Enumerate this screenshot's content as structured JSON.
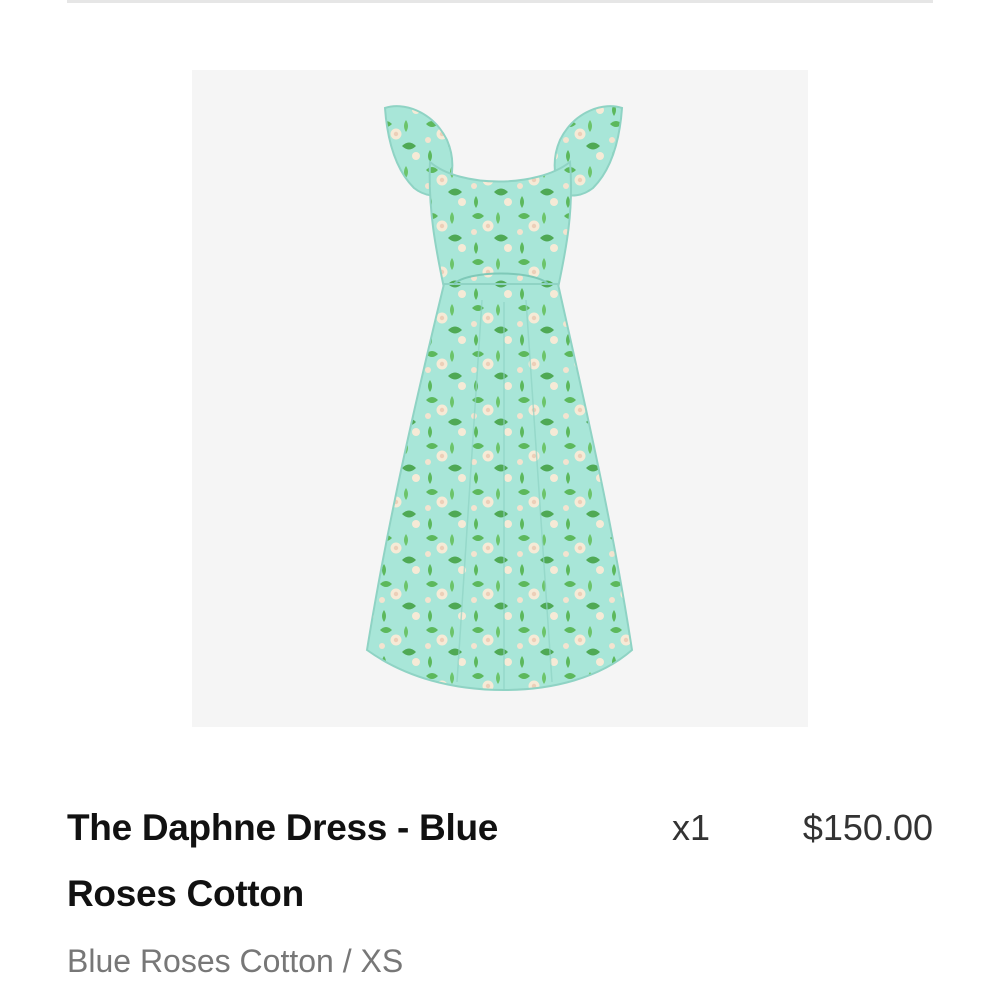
{
  "product": {
    "image_icon": "floral-midi-dress",
    "title": "The Daphne Dress - Blue Roses Cotton",
    "quantity": "x1",
    "price": "$150.00",
    "variant": "Blue Roses Cotton / XS"
  },
  "colors": {
    "image_background": "#f5f5f5",
    "dress_base": "#a8e6d8",
    "leaf_green": "#5cb85c",
    "rose_cream": "#f6ead6",
    "title_text": "#111111",
    "secondary_text": "#777777"
  }
}
